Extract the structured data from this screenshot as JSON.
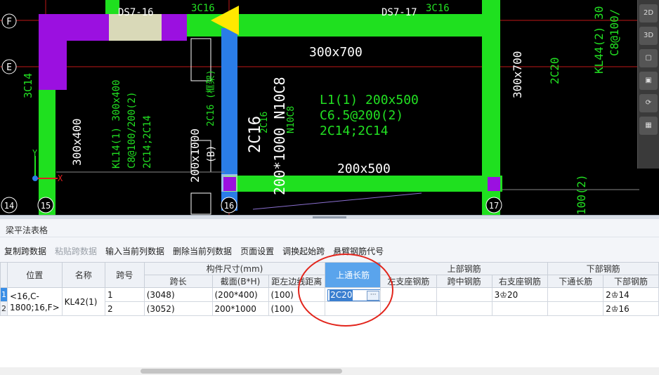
{
  "cad": {
    "axis_labels": [
      "F",
      "E",
      "14",
      "15",
      "16",
      "17"
    ],
    "beam_labels": {
      "ds7_16": "DS7-16",
      "ds7_17": "DS7-17",
      "c16_top": "3C16",
      "c16_top2": "3C16",
      "size_300x700_h": "300x700",
      "size_300x700_v": "300x700",
      "c20_v": "2C20",
      "kl44": "KL44(2) 30",
      "kl44_2": "C8@100/",
      "c14_left": "3C14",
      "size_300x400": "300x400",
      "kl14_1": "KL14(1) 300x400",
      "kl14_2": "C8@100/200(2)",
      "kl14_3": "2C14;2C14",
      "size_200x1000": "200x1000",
      "b_bottom": "(B)",
      "c16_mid": "2C16 (框架)",
      "c16_big": "2C16",
      "n10c8": "200*1000 N10C8",
      "c16_small": "2C16",
      "n10c8_2": "N10C8",
      "l1_1": "L1(1) 200x500",
      "l1_2": "C6.5@200(2)",
      "l1_3": "2C14;2C14",
      "size_200x500": "200x500",
      "k_100": "100(2)"
    },
    "axes_indicator": {
      "x": "X",
      "y": "Y"
    }
  },
  "panel": {
    "title": "梁平法表格",
    "toolbar": [
      {
        "label": "复制跨数据",
        "enabled": true
      },
      {
        "label": "粘贴跨数据",
        "enabled": false
      },
      {
        "label": "输入当前列数据",
        "enabled": true
      },
      {
        "label": "删除当前列数据",
        "enabled": true
      },
      {
        "label": "页面设置",
        "enabled": true
      },
      {
        "label": "调换起始跨",
        "enabled": true
      },
      {
        "label": "悬臂钢筋代号",
        "enabled": true
      }
    ],
    "headers": {
      "position": "位置",
      "name": "名称",
      "span_no": "跨号",
      "dims_group": "构件尺寸(mm)",
      "span_length": "跨长",
      "section": "截面(B*H)",
      "edge_dist": "距左边线距离",
      "top_through": "上通长筋",
      "top_group": "上部钢筋",
      "left_support": "左支座钢筋",
      "mid_span": "跨中钢筋",
      "right_support": "右支座钢筋",
      "bottom_group": "下部钢筋",
      "bottom_through": "下通长筋",
      "bottom_rebar": "下部钢筋"
    },
    "rows": [
      {
        "row_no": "1",
        "position": "<16,C-1800;16,F>",
        "name": "KL42(1)",
        "span_no": "1",
        "span_length": "(3048)",
        "section": "(200*400)",
        "edge_dist": "(100)",
        "top_through": "2C20",
        "left_support": "",
        "mid_span": "",
        "right_support": "3♔20",
        "bottom_through": "",
        "bottom_rebar": "2♔14"
      },
      {
        "row_no": "2",
        "span_no": "2",
        "span_length": "(3052)",
        "section": "200*1000",
        "edge_dist": "(100)",
        "top_through": "",
        "left_support": "",
        "mid_span": "",
        "right_support": "",
        "bottom_through": "",
        "bottom_rebar": "2♔16"
      }
    ],
    "ellipsis": "···"
  },
  "colors": {
    "beam_green": "#1fe01f",
    "column_purple": "#9b10e0",
    "selected_blue": "#3b7fd0",
    "annotation_red": "#e2241b",
    "cad_text_green": "#22e022"
  }
}
